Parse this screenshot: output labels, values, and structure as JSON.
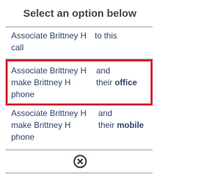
{
  "header": {
    "title": "Select an option below"
  },
  "options": [
    {
      "left_lines": [
        "Associate Brittney  H",
        "call"
      ],
      "right_lines": [
        "to this"
      ],
      "right_bold": ""
    },
    {
      "left_lines": [
        "Associate Brittney  H",
        "make Brittney H",
        "phone"
      ],
      "right_lines": [
        "and",
        "their "
      ],
      "right_bold": "office"
    },
    {
      "left_lines": [
        "Associate Brittney  H",
        "make Brittney H",
        "phone"
      ],
      "right_lines": [
        "and",
        "their "
      ],
      "right_bold": "mobile"
    }
  ],
  "close": {
    "icon": "close-circle-icon"
  },
  "colors": {
    "highlight_border": "#d32431",
    "text": "#2f4066",
    "header": "#444444",
    "divider": "#9a9a9a"
  }
}
